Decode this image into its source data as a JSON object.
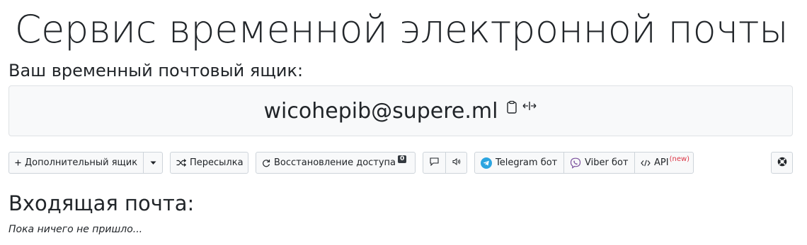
{
  "header": {
    "title": "Сервис временной электронной почты"
  },
  "mailbox": {
    "label": "Ваш временный почтовый ящик:",
    "address": "wicohepib@supere.ml",
    "copy_icon": "clipboard-icon",
    "resize_icon": "expand-horizontal-icon"
  },
  "toolbar": {
    "additional_mailbox": "Дополнительный ящик",
    "forwarding": "Пересылка",
    "restore_access": "Восстановление доступа",
    "restore_badge": "0",
    "telegram_bot": "Telegram бот",
    "viber_bot": "Viber бот",
    "api": "API",
    "api_new": "(new)"
  },
  "inbox": {
    "title": "Входящая почта:",
    "empty_message": "Пока ничего не пришло..."
  },
  "colors": {
    "telegram": "#2ca5e0",
    "viber": "#7b519d",
    "new_tag": "#dc3545",
    "badge": "#343a40"
  }
}
